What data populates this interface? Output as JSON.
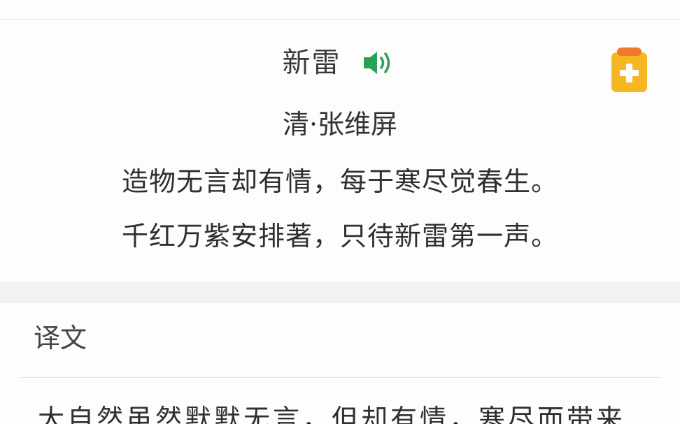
{
  "poem": {
    "title": "新雷",
    "author": "清·张维屏",
    "lines": [
      "造物无言却有情，每于寒尽觉春生。",
      "千红万紫安排著，只待新雷第一声。"
    ]
  },
  "icons": {
    "speaker": "speaker-icon",
    "add": "clipboard-add-icon"
  },
  "translation": {
    "heading": "译文",
    "text": "大自然虽然默默无言，但却有情，寒尽而带来"
  },
  "colors": {
    "accent_green": "#2aa157",
    "add_button_orange": "#f7b623",
    "add_button_clip": "#ef7a2b"
  }
}
